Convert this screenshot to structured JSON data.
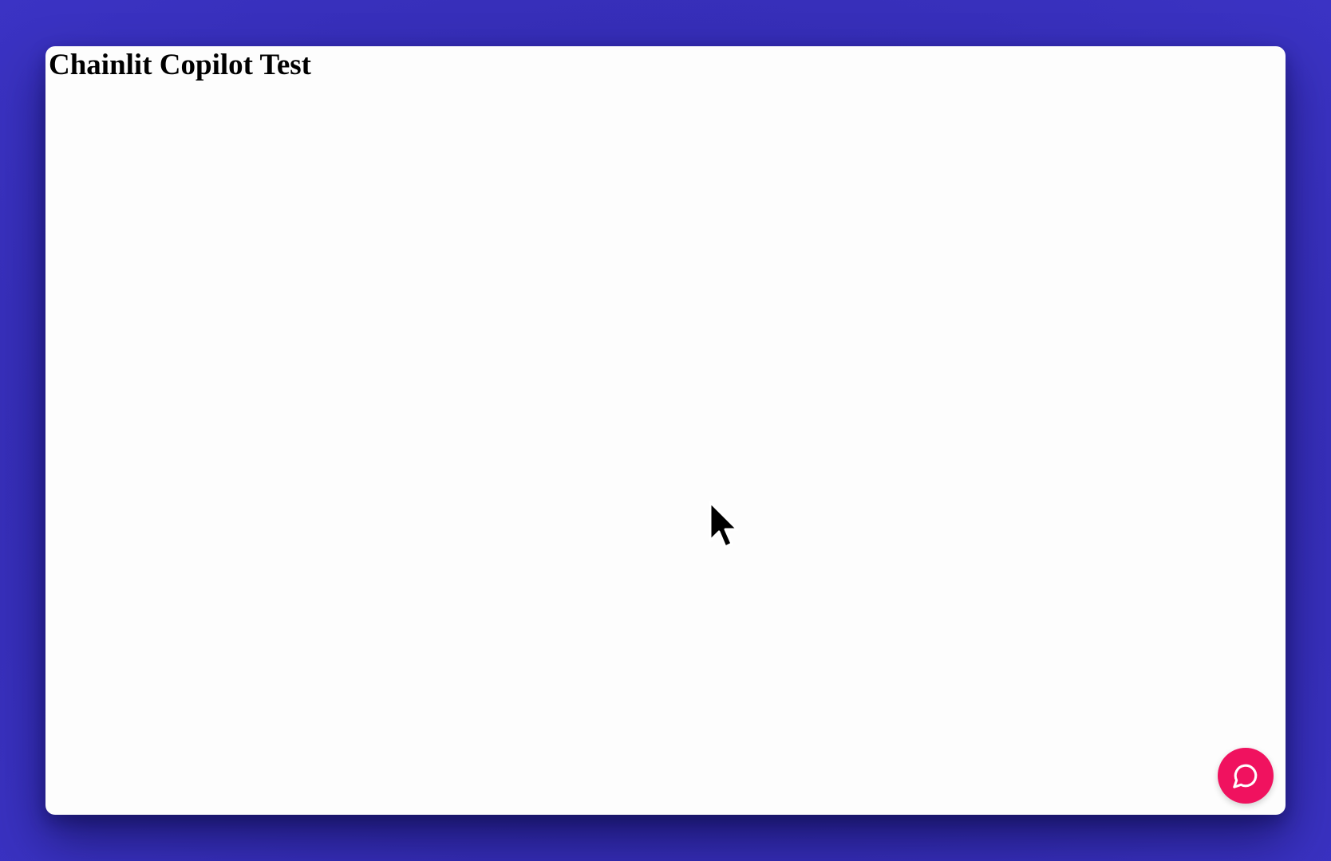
{
  "page": {
    "title": "Chainlit Copilot Test"
  },
  "copilot": {
    "icon": "chat-bubble-icon",
    "accent_color": "#f0125f"
  },
  "colors": {
    "background": "#3a32bd",
    "window": "#fdfdfd"
  },
  "cursor": {
    "icon": "mouse-pointer-icon"
  }
}
